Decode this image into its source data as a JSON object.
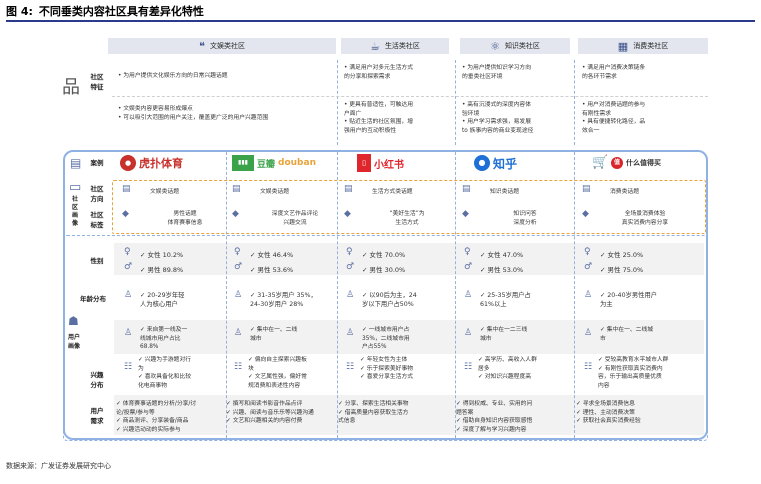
{
  "title": {
    "num": "图 4:",
    "text": "不同垂类内容社区具有差异化特性"
  },
  "columns": [
    {
      "icon": "quote-icon",
      "label": "文娱类社区"
    },
    {
      "icon": "coffee-icon",
      "label": "生活类社区"
    },
    {
      "icon": "atom-icon",
      "label": "知识类社区"
    },
    {
      "icon": "shop-icon",
      "label": "消费类社区"
    }
  ],
  "rows_top": {
    "features_label": "社区\n特征",
    "advantage_label": "社区\n优势",
    "features": [
      [
        "• 为用户提供文化娱乐方向的日常兴趣话题"
      ],
      [
        "• 满足用户对多元生活方式",
        "  的分享和探索需求"
      ],
      [
        "• 为用户提供知识学习方向",
        "  的垂类社区环境"
      ],
      [
        "• 满足用户消费决策链条",
        "  的各环节需求"
      ]
    ],
    "advantages": [
      [
        "• 文娱类内容更容易形成爆点",
        "• 可以吸引大范围的用户关注，覆盖更广泛的用户兴趣范围"
      ],
      [
        "• 更具有普适性，可触达用",
        "  户面广",
        "• 贴近生活的社区氛围，增",
        "  强用户的互动积极性"
      ],
      [
        "• 高有沉浸式的深度内容体",
        "  验环境",
        "• 用户学习需求强，易发展",
        "  to 族事内容的商业变现途径"
      ],
      [
        "• 用户对消费话题的参与",
        "  有刚性需求",
        "• 具有便捷转化路径，品",
        "  效合一"
      ]
    ]
  },
  "panel": {
    "case_label": "案例",
    "portrait_label": "社区\n画像",
    "community_dir_label": "社区\n方向",
    "community_tag_label": "社区\n标签",
    "user_portrait_label": "用户\n画像",
    "gender_label": "性别",
    "age_label": "年龄分布",
    "city_label": "城市\n分布",
    "interest_label": "兴趣\n分布",
    "needs_label": "用户\n需求"
  },
  "logos": [
    {
      "name": "虎扑体育",
      "color": "#c8302b"
    },
    {
      "name": "豆瓣",
      "latin": "douban",
      "color": "#3aa34a"
    },
    {
      "name": "小红书",
      "color": "#e0262d"
    },
    {
      "name": "知乎",
      "color": "#1e6fd6"
    },
    {
      "name": "什么值得买",
      "color": "#d9252a"
    }
  ],
  "cases": [
    {
      "dir": "文娱类话题",
      "tag": [
        "男性话题",
        "体育赛事信息"
      ],
      "female": "✓ 女性 10.2%",
      "male": "✓ 男性 89.8%",
      "age": [
        "✓ 20-29岁年轻",
        "  人为核心用户"
      ],
      "city": [
        "✓ 来自第一线及一",
        "  线城市用户占比",
        "  68.8%"
      ],
      "interest": [
        "✓ 兴趣为手游题对行",
        "  为",
        "✓ 喜欢具备化和比较",
        "  化电商事物"
      ],
      "needs": [
        "✓ 体育赛事话题的分析/分享/讨",
        "  论/投票/参与等",
        "✓ 商品测评、分享装备/商品",
        "✓ 兴趣活动动的实际参与"
      ]
    },
    {
      "dir": "文娱类话题",
      "tag": [
        "深度文艺作品评论",
        "兴趣交流"
      ],
      "female": "✓ 女性 46.4%",
      "male": "✓ 男性 53.6%",
      "age": [
        "✓ 31-35岁用户 35%，",
        "  24-30岁用户 28%"
      ],
      "city": [
        "✓ 集中在一、二线",
        "  城市"
      ],
      "interest": [
        "✓ 偏向自主探索兴趣板",
        "  块",
        "✓ 文艺属性强，偏好常",
        "  规消费和表述性内容"
      ],
      "needs": [
        "✓ 撰写和阅读书影音作品点评",
        "✓ 兴趣、阅读与音乐乐等兴趣沟通",
        "✓ 文艺和兴趣相关的内容付费"
      ]
    },
    {
      "dir": "生活方式类话题",
      "tag": [
        "“美好生活”为",
        "生活方式"
      ],
      "female": "✓ 女性 70.0%",
      "male": "✓ 男性 30.0%",
      "age": [
        "✓ 以90后为主，24",
        "  岁以下用户占50%"
      ],
      "city": [
        "✓ 一线城市用户占",
        "  35%，二线城市用",
        "  户占55%"
      ],
      "interest": [
        "✓ 年轻女性为主体",
        "✓ 乐于探索美好事物",
        "✓ 喜爱分享生活方式"
      ],
      "needs": [
        "✓ 分享、探索生活相关事物",
        "✓ 借高质量内容获取生活方",
        "  式信息"
      ]
    },
    {
      "dir": "知识类话题",
      "tag": [
        "知识问答",
        "深度分析"
      ],
      "female": "✓ 女性 47.0%",
      "male": "✓ 男性 53.0%",
      "age": [
        "✓ 25-35岁用户占",
        "  61%以上"
      ],
      "city": [
        "✓ 集中在一二三线",
        "  城市"
      ],
      "interest": [
        "✓ 高学历、高收入人群",
        "  居多",
        "✓ 对知识兴趣程度高"
      ],
      "needs": [
        "✓ 得到权威、专业、实用的问",
        "  题答案",
        "✓ 借助自身知识内容获取感悟",
        "✓ 深度了解与学习兴趣内容"
      ]
    },
    {
      "dir": "消费类话题",
      "tag": [
        "全场景消费体验",
        "真实消费内容分享"
      ],
      "female": "✓ 女性 25.0%",
      "male": "✓ 男性 75.0%",
      "age": [
        "✓ 20-40岁男性用户",
        "  为主"
      ],
      "city": [
        "✓ 集中在一、二线城",
        "  市"
      ],
      "interest": [
        "✓ 受较高教育水平城市人群",
        "✓ 有刚性获取真实消费内",
        "  容，乐于输出高质量优质",
        "  内容"
      ],
      "needs": [
        "✓ 寻求全场景消费信息",
        "✓ 理性、主动消费决策",
        "✓ 获取社会真实消费经验"
      ]
    }
  ],
  "footer": "数据来源：广发证券发展研究中心"
}
